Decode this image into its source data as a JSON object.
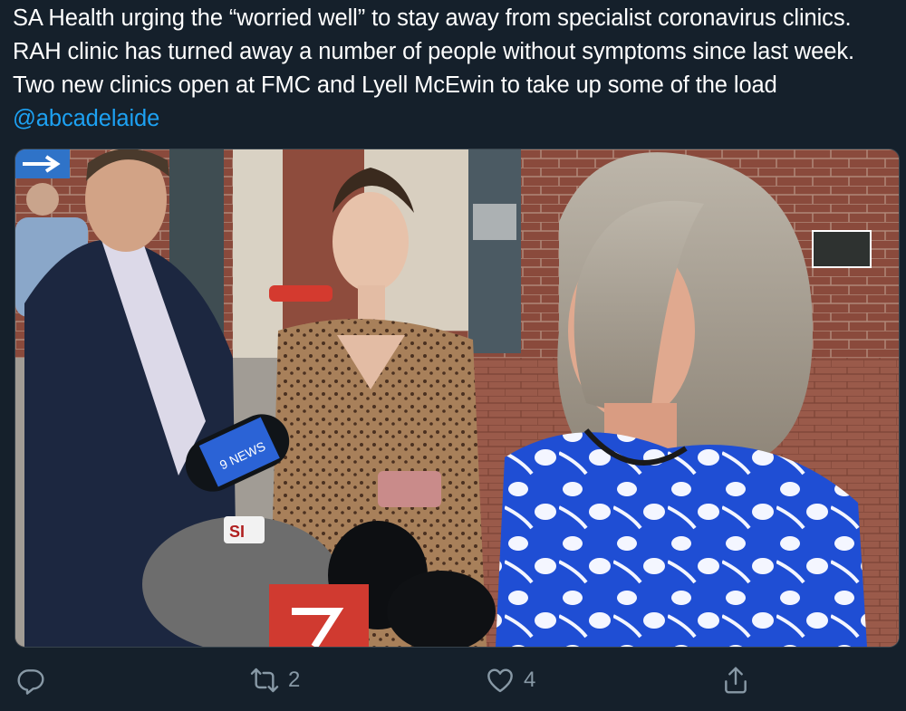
{
  "tweet": {
    "text": "SA Health urging the “worried well” to stay away from specialist coronavirus clinics. RAH clinic has turned away a number of people without symptoms since last week. Two new clinics open at FMC and Lyell McEwin to take up some of the load ",
    "mention": "@abcadelaide"
  },
  "media": {
    "mic_logo_text": "9 NEWS",
    "mic_sign_text": "SI"
  },
  "actions": {
    "reply_icon": "reply-icon",
    "retweet_icon": "retweet-icon",
    "retweet_count": "2",
    "like_icon": "like-icon",
    "like_count": "4",
    "share_icon": "share-icon"
  },
  "colors": {
    "background": "#15202b",
    "text": "#ffffff",
    "link": "#1da1f2",
    "muted": "#8899a6"
  }
}
